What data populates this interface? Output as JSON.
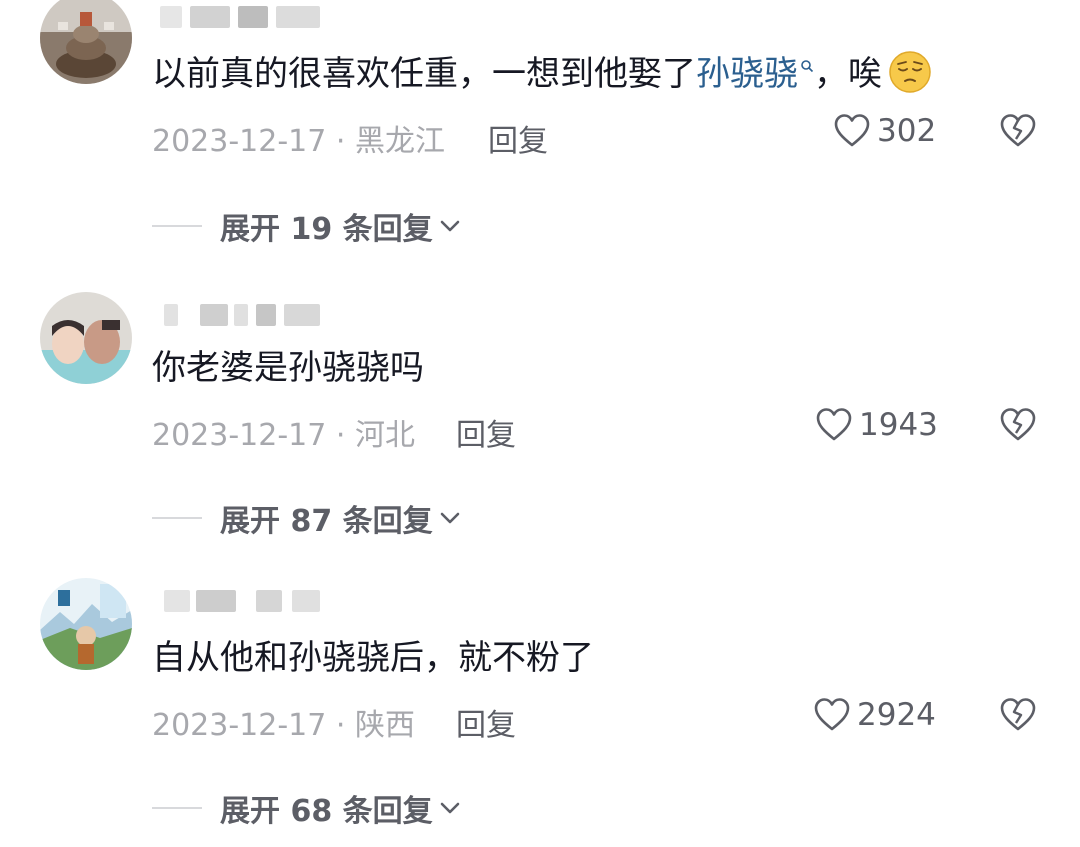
{
  "comments": [
    {
      "text_before": "以前真的很喜欢任重，一想到他娶了",
      "mention": "孙骁骁",
      "text_after": "，唉",
      "emoji": "pensive-face",
      "date": "2023-12-17",
      "location": "黑龙江",
      "reply_label": "回复",
      "likes": "302",
      "expand_label": "展开 19 条回复"
    },
    {
      "text": "你老婆是孙骁骁吗",
      "date": "2023-12-17",
      "location": "河北",
      "reply_label": "回复",
      "likes": "1943",
      "expand_label": "展开 87 条回复"
    },
    {
      "text": "自从他和孙骁骁后，就不粉了",
      "date": "2023-12-17",
      "location": "陕西",
      "reply_label": "回复",
      "likes": "2924",
      "expand_label": "展开 68 条回复"
    }
  ],
  "colors": {
    "text": "#161823",
    "meta": "#a7a8ad",
    "action": "#5c5e66",
    "mention": "#2b5f8f"
  }
}
